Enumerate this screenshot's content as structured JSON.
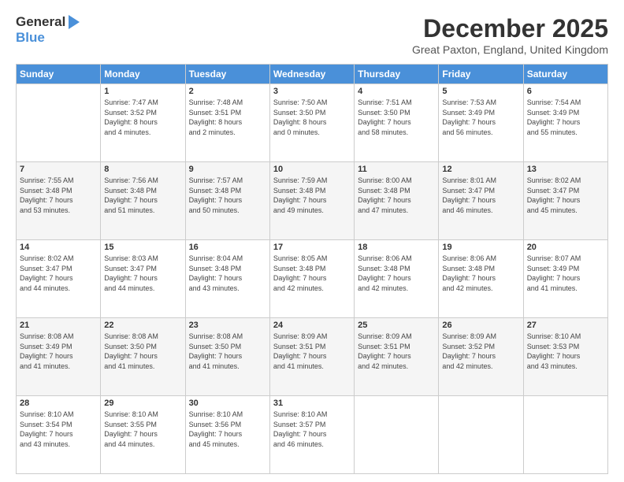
{
  "logo": {
    "general": "General",
    "blue": "Blue"
  },
  "header": {
    "title": "December 2025",
    "location": "Great Paxton, England, United Kingdom"
  },
  "weekdays": [
    "Sunday",
    "Monday",
    "Tuesday",
    "Wednesday",
    "Thursday",
    "Friday",
    "Saturday"
  ],
  "weeks": [
    [
      {
        "day": "",
        "info": ""
      },
      {
        "day": "1",
        "info": "Sunrise: 7:47 AM\nSunset: 3:52 PM\nDaylight: 8 hours\nand 4 minutes."
      },
      {
        "day": "2",
        "info": "Sunrise: 7:48 AM\nSunset: 3:51 PM\nDaylight: 8 hours\nand 2 minutes."
      },
      {
        "day": "3",
        "info": "Sunrise: 7:50 AM\nSunset: 3:50 PM\nDaylight: 8 hours\nand 0 minutes."
      },
      {
        "day": "4",
        "info": "Sunrise: 7:51 AM\nSunset: 3:50 PM\nDaylight: 7 hours\nand 58 minutes."
      },
      {
        "day": "5",
        "info": "Sunrise: 7:53 AM\nSunset: 3:49 PM\nDaylight: 7 hours\nand 56 minutes."
      },
      {
        "day": "6",
        "info": "Sunrise: 7:54 AM\nSunset: 3:49 PM\nDaylight: 7 hours\nand 55 minutes."
      }
    ],
    [
      {
        "day": "7",
        "info": "Sunrise: 7:55 AM\nSunset: 3:48 PM\nDaylight: 7 hours\nand 53 minutes."
      },
      {
        "day": "8",
        "info": "Sunrise: 7:56 AM\nSunset: 3:48 PM\nDaylight: 7 hours\nand 51 minutes."
      },
      {
        "day": "9",
        "info": "Sunrise: 7:57 AM\nSunset: 3:48 PM\nDaylight: 7 hours\nand 50 minutes."
      },
      {
        "day": "10",
        "info": "Sunrise: 7:59 AM\nSunset: 3:48 PM\nDaylight: 7 hours\nand 49 minutes."
      },
      {
        "day": "11",
        "info": "Sunrise: 8:00 AM\nSunset: 3:48 PM\nDaylight: 7 hours\nand 47 minutes."
      },
      {
        "day": "12",
        "info": "Sunrise: 8:01 AM\nSunset: 3:47 PM\nDaylight: 7 hours\nand 46 minutes."
      },
      {
        "day": "13",
        "info": "Sunrise: 8:02 AM\nSunset: 3:47 PM\nDaylight: 7 hours\nand 45 minutes."
      }
    ],
    [
      {
        "day": "14",
        "info": "Sunrise: 8:02 AM\nSunset: 3:47 PM\nDaylight: 7 hours\nand 44 minutes."
      },
      {
        "day": "15",
        "info": "Sunrise: 8:03 AM\nSunset: 3:47 PM\nDaylight: 7 hours\nand 44 minutes."
      },
      {
        "day": "16",
        "info": "Sunrise: 8:04 AM\nSunset: 3:48 PM\nDaylight: 7 hours\nand 43 minutes."
      },
      {
        "day": "17",
        "info": "Sunrise: 8:05 AM\nSunset: 3:48 PM\nDaylight: 7 hours\nand 42 minutes."
      },
      {
        "day": "18",
        "info": "Sunrise: 8:06 AM\nSunset: 3:48 PM\nDaylight: 7 hours\nand 42 minutes."
      },
      {
        "day": "19",
        "info": "Sunrise: 8:06 AM\nSunset: 3:48 PM\nDaylight: 7 hours\nand 42 minutes."
      },
      {
        "day": "20",
        "info": "Sunrise: 8:07 AM\nSunset: 3:49 PM\nDaylight: 7 hours\nand 41 minutes."
      }
    ],
    [
      {
        "day": "21",
        "info": "Sunrise: 8:08 AM\nSunset: 3:49 PM\nDaylight: 7 hours\nand 41 minutes."
      },
      {
        "day": "22",
        "info": "Sunrise: 8:08 AM\nSunset: 3:50 PM\nDaylight: 7 hours\nand 41 minutes."
      },
      {
        "day": "23",
        "info": "Sunrise: 8:08 AM\nSunset: 3:50 PM\nDaylight: 7 hours\nand 41 minutes."
      },
      {
        "day": "24",
        "info": "Sunrise: 8:09 AM\nSunset: 3:51 PM\nDaylight: 7 hours\nand 41 minutes."
      },
      {
        "day": "25",
        "info": "Sunrise: 8:09 AM\nSunset: 3:51 PM\nDaylight: 7 hours\nand 42 minutes."
      },
      {
        "day": "26",
        "info": "Sunrise: 8:09 AM\nSunset: 3:52 PM\nDaylight: 7 hours\nand 42 minutes."
      },
      {
        "day": "27",
        "info": "Sunrise: 8:10 AM\nSunset: 3:53 PM\nDaylight: 7 hours\nand 43 minutes."
      }
    ],
    [
      {
        "day": "28",
        "info": "Sunrise: 8:10 AM\nSunset: 3:54 PM\nDaylight: 7 hours\nand 43 minutes."
      },
      {
        "day": "29",
        "info": "Sunrise: 8:10 AM\nSunset: 3:55 PM\nDaylight: 7 hours\nand 44 minutes."
      },
      {
        "day": "30",
        "info": "Sunrise: 8:10 AM\nSunset: 3:56 PM\nDaylight: 7 hours\nand 45 minutes."
      },
      {
        "day": "31",
        "info": "Sunrise: 8:10 AM\nSunset: 3:57 PM\nDaylight: 7 hours\nand 46 minutes."
      },
      {
        "day": "",
        "info": ""
      },
      {
        "day": "",
        "info": ""
      },
      {
        "day": "",
        "info": ""
      }
    ]
  ]
}
